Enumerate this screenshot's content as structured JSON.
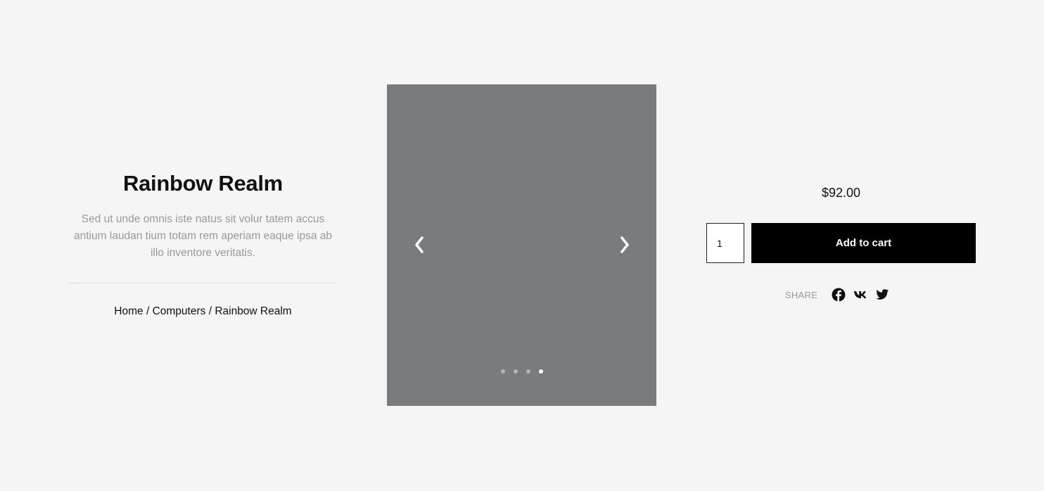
{
  "product": {
    "title": "Rainbow Realm",
    "description": "Sed ut unde omnis iste natus sit volur tatem accus antium laudan tium totam rem aperiam eaque ipsa ab illo inventore veritatis.",
    "price": "$92.00"
  },
  "breadcrumb": {
    "items": [
      "Home",
      "Computers",
      "Rainbow Realm"
    ],
    "separator": "/"
  },
  "gallery": {
    "slide_count": 4,
    "active_slide": 4,
    "background_color": "#7a7b7c"
  },
  "cart": {
    "quantity": "1",
    "add_label": "Add to cart"
  },
  "share": {
    "label": "SHARE",
    "icons": [
      "facebook-icon",
      "vk-icon",
      "twitter-icon"
    ]
  }
}
